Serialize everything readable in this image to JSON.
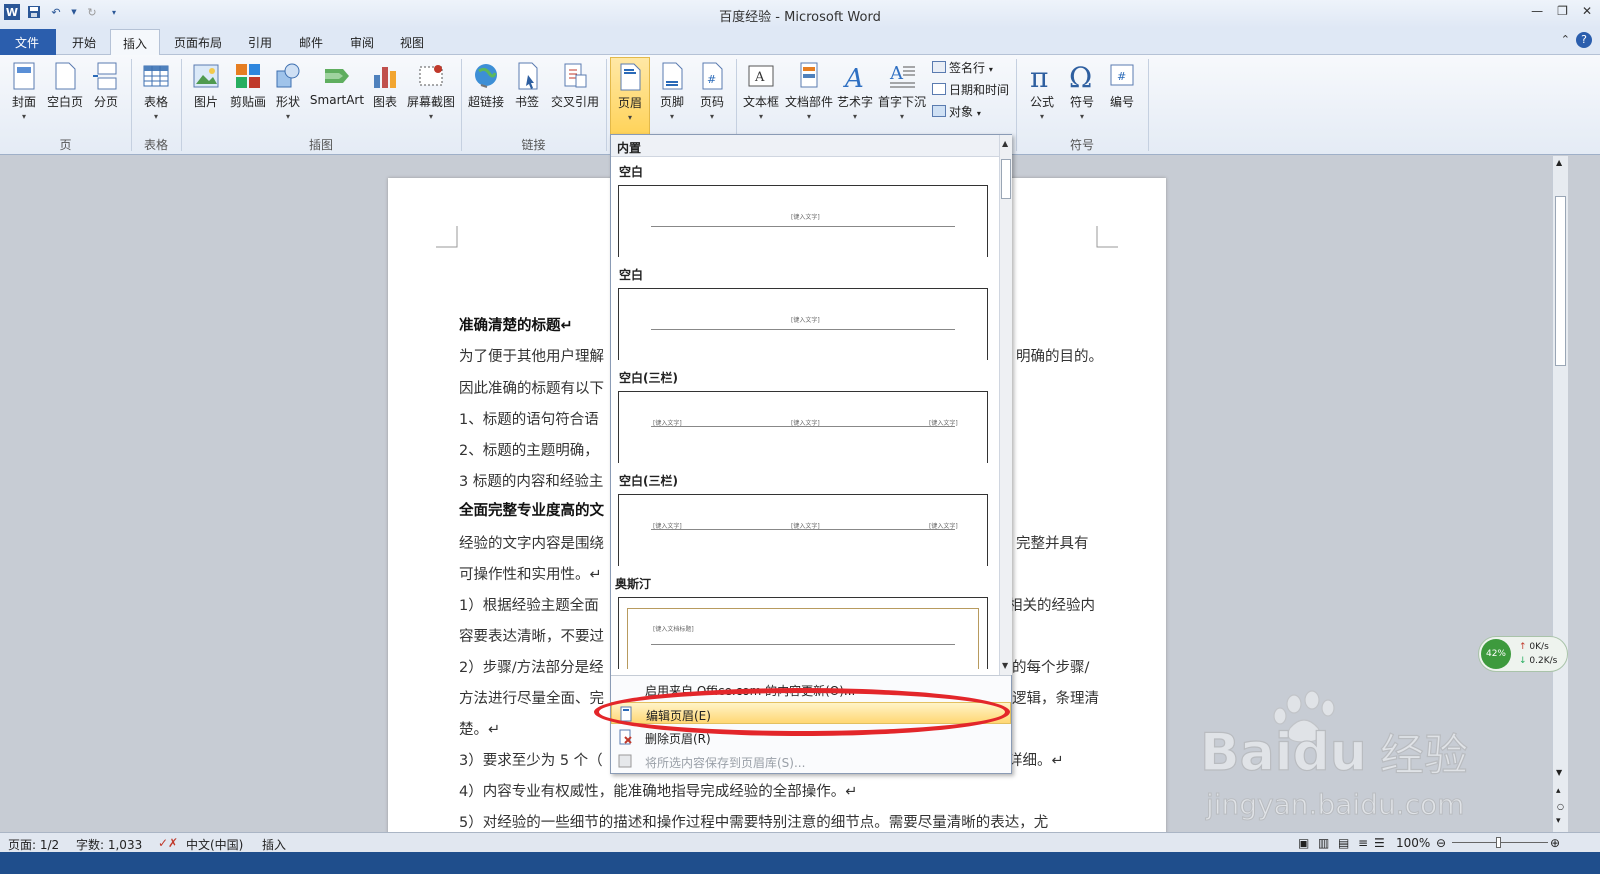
{
  "window": {
    "title": "百度经验 - Microsoft Word"
  },
  "tabs": [
    {
      "label": "文件"
    },
    {
      "label": "开始"
    },
    {
      "label": "插入"
    },
    {
      "label": "页面布局"
    },
    {
      "label": "引用"
    },
    {
      "label": "邮件"
    },
    {
      "label": "审阅"
    },
    {
      "label": "视图"
    }
  ],
  "ribbon": {
    "groups": {
      "page": "页",
      "table": "表格",
      "illustrations": "插图",
      "links": "链接",
      "symbols": "符号"
    },
    "buttons": {
      "cover": "封面",
      "blank_page": "空白页",
      "page_break": "分页",
      "table": "表格",
      "picture": "图片",
      "clipart": "剪贴画",
      "shapes": "形状",
      "smartart": "SmartArt",
      "chart": "图表",
      "screenshot": "屏幕截图",
      "hyperlink": "超链接",
      "bookmark": "书签",
      "cross_ref": "交叉引用",
      "header": "页眉",
      "footer": "页脚",
      "page_number": "页码",
      "textbox": "文本框",
      "quick_parts": "文档部件",
      "wordart": "艺术字",
      "dropcap": "首字下沉",
      "signature": "签名行",
      "datetime": "日期和时间",
      "object": "对象",
      "equation": "公式",
      "symbol": "符号",
      "number": "编号"
    }
  },
  "dropdown": {
    "header": "内置",
    "sections": [
      {
        "title": "空白",
        "placeholder": "[键入文字]"
      },
      {
        "title": "空白",
        "placeholder": "[键入文字]"
      },
      {
        "title": "空白(三栏)",
        "placeholders": [
          "[键入文字]",
          "[键入文字]",
          "[键入文字]"
        ]
      },
      {
        "title": "空白(三栏)",
        "placeholders": [
          "[键入文字]",
          "[键入文字]",
          "[键入文字]"
        ]
      },
      {
        "title": "奥斯汀",
        "placeholder": "[键入文档标题]"
      }
    ],
    "menu": {
      "office_update": "启用来自 Office.com 的内容更新(O)...",
      "edit_header": "编辑页眉(E)",
      "remove_header": "删除页眉(R)",
      "save_selection": "将所选内容保存到页眉库(S)..."
    }
  },
  "document": {
    "lines": [
      {
        "text": "准确清楚的标题↵",
        "bold": true
      },
      {
        "text": "为了便于其他用户理解"
      },
      {
        "text": "因此准确的标题有以下"
      },
      {
        "text": "1、标题的语句符合语"
      },
      {
        "text": "2、标题的主题明确，"
      },
      {
        "text": "3 标题的内容和经验主"
      },
      {
        "text": "全面完整专业度高的文",
        "bold": true
      },
      {
        "text": "经验的文字内容是围绕"
      },
      {
        "text": "可操作性和实用性。↵"
      },
      {
        "text": "1）根据经验主题全面"
      },
      {
        "text": "容要表达清晰，不要过"
      },
      {
        "text": "2）步骤/方法部分是经"
      },
      {
        "text": "方法进行尽量全面、完"
      },
      {
        "text": "楚。↵"
      },
      {
        "text": "3）要求至少为 5 个（"
      },
      {
        "text": "4）内容专业有权威性，能准确地指导完成经验的全部操作。↵"
      },
      {
        "text": "5）对经验的一些细节的描述和操作过程中需要特别注意的细节点。需要尽量清晰的表达，尤"
      }
    ],
    "right_fragments": [
      {
        "text": "明确的目的。"
      },
      {
        "text": "完整并具有"
      },
      {
        "text": "相关的经验内"
      },
      {
        "text": "的每个步骤/"
      },
      {
        "text": "逻辑，条理清"
      },
      {
        "text": "详细。↵"
      }
    ]
  },
  "statusbar": {
    "page": "页面: 1/2",
    "words": "字数: 1,033",
    "language": "中文(中国)",
    "mode": "插入",
    "zoom": "100%"
  },
  "netwidget": {
    "percent": "42%",
    "up": "0K/s",
    "down": "0.2K/s"
  },
  "watermark": {
    "brand": "Baidu",
    "site": "jingyan.baidu.com",
    "label": "经验"
  }
}
